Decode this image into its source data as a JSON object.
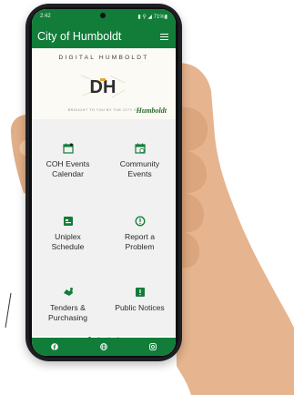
{
  "status_bar": {
    "time": "2:42",
    "indicators": "▮ ⚲ ◢ 71%▮"
  },
  "app_bar": {
    "title": "City of Humboldt",
    "menu_icon": "hamburger-menu-icon"
  },
  "banner": {
    "tagline": "DIGITAL HUMBOLDT",
    "logo_text": "DH",
    "footer_text": "BROUGHT TO YOU BY THE CITY OF",
    "brand": "Humboldt"
  },
  "tiles": [
    {
      "label_line1": "COH Events",
      "label_line2": "Calendar",
      "icon": "calendar-icon"
    },
    {
      "label_line1": "Community",
      "label_line2": "Events",
      "icon": "calendar-check-icon"
    },
    {
      "label_line1": "Uniplex",
      "label_line2": "Schedule",
      "icon": "schedule-icon"
    },
    {
      "label_line1": "Report a",
      "label_line2": "Problem",
      "icon": "alert-icon"
    },
    {
      "label_line1": "Tenders &",
      "label_line2": "Purchasing",
      "icon": "handshake-icon"
    },
    {
      "label_line1": "Public Notices",
      "label_line2": "",
      "icon": "notice-icon"
    }
  ],
  "pagination": {
    "pages": 4,
    "current_page": 1
  },
  "bottom_nav": [
    {
      "icon": "facebook-icon"
    },
    {
      "icon": "globe-icon"
    },
    {
      "icon": "instagram-icon"
    }
  ],
  "colors": {
    "primary": "#127d39",
    "tile_background": "#f1f1f1",
    "skin": "#e6b48e"
  }
}
